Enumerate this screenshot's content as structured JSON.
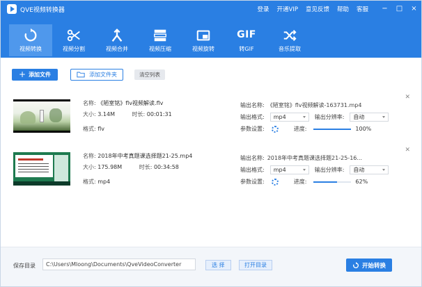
{
  "app": {
    "title": "QVE视频转换器"
  },
  "top_links": [
    "登录",
    "开通VIP",
    "意见反馈",
    "帮助",
    "客服"
  ],
  "window_controls": [
    "−",
    "□",
    "×"
  ],
  "nav": [
    {
      "label": "视频转换",
      "icon": "refresh-icon",
      "active": true
    },
    {
      "label": "视频分割",
      "icon": "scissors-icon",
      "active": false
    },
    {
      "label": "视频合并",
      "icon": "merge-icon",
      "active": false
    },
    {
      "label": "视频压缩",
      "icon": "compress-icon",
      "active": false
    },
    {
      "label": "视频旋转",
      "icon": "rotate-icon",
      "active": false
    },
    {
      "label": "转GIF",
      "icon": "gif-icon",
      "active": false
    },
    {
      "label": "音乐提取",
      "icon": "shuffle-icon",
      "active": false
    }
  ],
  "nav_gif_text": "GIF",
  "toolbar": {
    "add_file": "添加文件",
    "add_folder": "添加文件夹",
    "clear_list": "清空列表"
  },
  "labels": {
    "name": "名称:",
    "size": "大小:",
    "duration": "时长:",
    "format": "格式:",
    "out_name": "输出名称:",
    "out_format": "输出格式:",
    "out_res": "输出分辨率:",
    "params": "参数设置:",
    "progress": "进度:"
  },
  "files": [
    {
      "name": "《陋室铭》flv视频解读.flv",
      "size": "3.14M",
      "duration": "00:01:31",
      "format": "flv",
      "out_name": "《陋室铭》flv视频解读-163731.mp4",
      "out_format": "mp4",
      "out_res": "自动",
      "progress_text": "100%",
      "progress": 1.0
    },
    {
      "name": "2018年中考真题课选择题21-25.mp4",
      "size": "175.98M",
      "duration": "00:34:58",
      "format": "mp4",
      "out_name": "2018年中考真题课选择题21-25-16...",
      "out_format": "mp4",
      "out_res": "自动",
      "progress_text": "62%",
      "progress": 0.62
    }
  ],
  "footer": {
    "save_dir_label": "保存目录",
    "save_path": "C:\\Users\\Mloong\\Documents\\QveVideoConverter",
    "choose": "选 择",
    "open_dir": "打开目录",
    "start": "开始转换"
  },
  "colors": {
    "accent": "#2a7fe3",
    "nav_active": "#4f98ec"
  }
}
